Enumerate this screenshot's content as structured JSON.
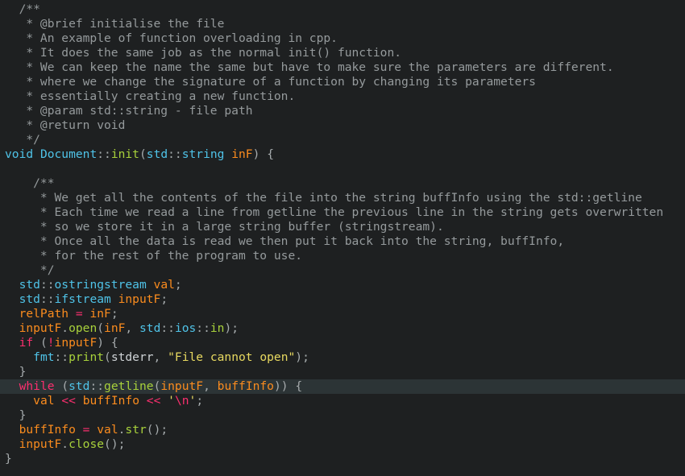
{
  "editor": {
    "highlighted_line": 26,
    "colors": {
      "background": "#1e2021",
      "current_line": "#2c3436",
      "comment": "#959a9c",
      "keyword": "#4fc3e8",
      "function": "#a8d13b",
      "variable": "#fb8c1e",
      "operator": "#fb2f6e",
      "string": "#e8d960",
      "text": "#cfd3d6"
    },
    "lines": [
      [
        [
          "cm",
          "  /**"
        ]
      ],
      [
        [
          "cm",
          "   * @brief initialise the file"
        ]
      ],
      [
        [
          "cm",
          "   * An example of function overloading in cpp."
        ]
      ],
      [
        [
          "cm",
          "   * It does the same job as the normal init() function."
        ]
      ],
      [
        [
          "cm",
          "   * We can keep the name the same but have to make sure the parameters are different."
        ]
      ],
      [
        [
          "cm",
          "   * where we change the signature of a function by changing its parameters"
        ]
      ],
      [
        [
          "cm",
          "   * essentially creating a new function."
        ]
      ],
      [
        [
          "cm",
          "   * @param std::string - file path"
        ]
      ],
      [
        [
          "cm",
          "   * @return void"
        ]
      ],
      [
        [
          "cm",
          "   */"
        ]
      ],
      [
        [
          "kw",
          "void"
        ],
        [
          "tx",
          " "
        ],
        [
          "ty",
          "Document"
        ],
        [
          "pu",
          "::"
        ],
        [
          "fn",
          "init"
        ],
        [
          "pu",
          "("
        ],
        [
          "ty",
          "std"
        ],
        [
          "pu",
          "::"
        ],
        [
          "ty",
          "string"
        ],
        [
          "tx",
          " "
        ],
        [
          "var",
          "inF"
        ],
        [
          "pu",
          ")"
        ],
        [
          "tx",
          " "
        ],
        [
          "pu",
          "{"
        ]
      ],
      [
        [
          "tx",
          ""
        ]
      ],
      [
        [
          "cm",
          "    /**"
        ]
      ],
      [
        [
          "cm",
          "     * We get all the contents of the file into the string buffInfo using the std::getline"
        ]
      ],
      [
        [
          "cm",
          "     * Each time we read a line from getline the previous line in the string gets overwritten"
        ]
      ],
      [
        [
          "cm",
          "     * so we store it in a large string buffer (stringstream)."
        ]
      ],
      [
        [
          "cm",
          "     * Once all the data is read we then put it back into the string, buffInfo,"
        ]
      ],
      [
        [
          "cm",
          "     * for the rest of the program to use."
        ]
      ],
      [
        [
          "cm",
          "     */"
        ]
      ],
      [
        [
          "tx",
          "  "
        ],
        [
          "ty",
          "std"
        ],
        [
          "pu",
          "::"
        ],
        [
          "ty",
          "ostringstream"
        ],
        [
          "tx",
          " "
        ],
        [
          "var",
          "val"
        ],
        [
          "pu",
          ";"
        ]
      ],
      [
        [
          "tx",
          "  "
        ],
        [
          "ty",
          "std"
        ],
        [
          "pu",
          "::"
        ],
        [
          "ty",
          "ifstream"
        ],
        [
          "tx",
          " "
        ],
        [
          "var",
          "inputF"
        ],
        [
          "pu",
          ";"
        ]
      ],
      [
        [
          "tx",
          "  "
        ],
        [
          "var",
          "relPath"
        ],
        [
          "tx",
          " "
        ],
        [
          "op",
          "="
        ],
        [
          "tx",
          " "
        ],
        [
          "var",
          "inF"
        ],
        [
          "pu",
          ";"
        ]
      ],
      [
        [
          "tx",
          "  "
        ],
        [
          "var",
          "inputF"
        ],
        [
          "pu",
          "."
        ],
        [
          "fn",
          "open"
        ],
        [
          "pu",
          "("
        ],
        [
          "var",
          "inF"
        ],
        [
          "pu",
          ","
        ],
        [
          "tx",
          " "
        ],
        [
          "ty",
          "std"
        ],
        [
          "pu",
          "::"
        ],
        [
          "ty",
          "ios"
        ],
        [
          "pu",
          "::"
        ],
        [
          "fn",
          "in"
        ],
        [
          "pu",
          ");"
        ]
      ],
      [
        [
          "tx",
          "  "
        ],
        [
          "op",
          "if"
        ],
        [
          "tx",
          " "
        ],
        [
          "pu",
          "("
        ],
        [
          "op",
          "!"
        ],
        [
          "var",
          "inputF"
        ],
        [
          "pu",
          ")"
        ],
        [
          "tx",
          " "
        ],
        [
          "pu",
          "{"
        ]
      ],
      [
        [
          "tx",
          "    "
        ],
        [
          "ty",
          "fmt"
        ],
        [
          "pu",
          "::"
        ],
        [
          "fn",
          "print"
        ],
        [
          "pu",
          "("
        ],
        [
          "tx",
          "stderr"
        ],
        [
          "pu",
          ","
        ],
        [
          "tx",
          " "
        ],
        [
          "str",
          "\"File cannot open\""
        ],
        [
          "pu",
          ");"
        ]
      ],
      [
        [
          "tx",
          "  "
        ],
        [
          "pu",
          "}"
        ]
      ],
      [
        [
          "tx",
          "  "
        ],
        [
          "op",
          "while"
        ],
        [
          "tx",
          " "
        ],
        [
          "pu",
          "("
        ],
        [
          "ty",
          "std"
        ],
        [
          "pu",
          "::"
        ],
        [
          "fn",
          "getline"
        ],
        [
          "pu",
          "("
        ],
        [
          "var",
          "inputF"
        ],
        [
          "pu",
          ","
        ],
        [
          "tx",
          " "
        ],
        [
          "var",
          "buffInfo"
        ],
        [
          "pu",
          "))"
        ],
        [
          "tx",
          " "
        ],
        [
          "pu",
          "{"
        ]
      ],
      [
        [
          "tx",
          "    "
        ],
        [
          "var",
          "val"
        ],
        [
          "tx",
          " "
        ],
        [
          "op",
          "<<"
        ],
        [
          "tx",
          " "
        ],
        [
          "var",
          "buffInfo"
        ],
        [
          "tx",
          " "
        ],
        [
          "op",
          "<<"
        ],
        [
          "tx",
          " "
        ],
        [
          "str",
          "'"
        ],
        [
          "cx",
          "\\n"
        ],
        [
          "str",
          "'"
        ],
        [
          "pu",
          ";"
        ]
      ],
      [
        [
          "tx",
          "  "
        ],
        [
          "pu",
          "}"
        ]
      ],
      [
        [
          "tx",
          "  "
        ],
        [
          "var",
          "buffInfo"
        ],
        [
          "tx",
          " "
        ],
        [
          "op",
          "="
        ],
        [
          "tx",
          " "
        ],
        [
          "var",
          "val"
        ],
        [
          "pu",
          "."
        ],
        [
          "fn",
          "str"
        ],
        [
          "pu",
          "();"
        ]
      ],
      [
        [
          "tx",
          "  "
        ],
        [
          "var",
          "inputF"
        ],
        [
          "pu",
          "."
        ],
        [
          "fn",
          "close"
        ],
        [
          "pu",
          "();"
        ]
      ],
      [
        [
          "pu",
          "}"
        ]
      ]
    ]
  }
}
